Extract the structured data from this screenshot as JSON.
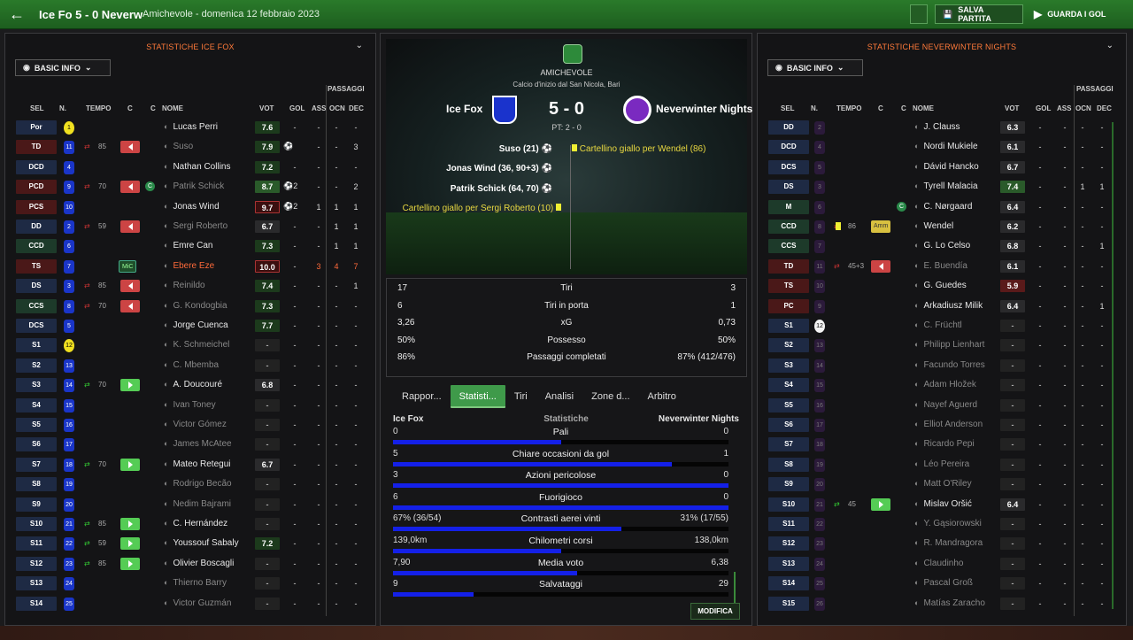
{
  "header": {
    "title": "Ice Fo 5 - 0 Neverw",
    "subtitle": "Amichevole - domenica 12 febbraio 2023",
    "save_label": "SALVA PARTITA",
    "watch_label": "GUARDA I GOL"
  },
  "left": {
    "title": "STATISTICHE ICE FOX",
    "view": "BASIC INFO",
    "passes_header": "PASSAGGI",
    "cols": {
      "sel": "SEL",
      "n": "N.",
      "tempo": "TEMPO",
      "c1": "C",
      "c2": "C",
      "nome": "NOME",
      "vot": "VOT",
      "gol": "GOL",
      "ass": "ASS",
      "ocn": "OCN",
      "dec": "DEC"
    },
    "players": [
      {
        "pos": "Por",
        "n": "1",
        "name": "Lucas Perri",
        "vot": "7.6",
        "gol": "-",
        "ass": "-",
        "ocn": "-",
        "dec": "-"
      },
      {
        "pos": "TD",
        "n": "11",
        "mins": "85",
        "name": "Suso",
        "vot": "7.9",
        "gol": "",
        "ass": "-",
        "ocn": "-",
        "dec": "3"
      },
      {
        "pos": "DCD",
        "n": "4",
        "name": "Nathan Collins",
        "vot": "7.2",
        "gol": "-",
        "ass": "-",
        "ocn": "-",
        "dec": "-"
      },
      {
        "pos": "PCD",
        "n": "9",
        "mins": "70",
        "name": "Patrik Schick",
        "vot": "8.7",
        "gol": "2",
        "ass": "-",
        "ocn": "-",
        "dec": "2"
      },
      {
        "pos": "PCS",
        "n": "10",
        "name": "Jonas Wind",
        "vot": "9.7",
        "gol": "2",
        "ass": "1",
        "ocn": "1",
        "dec": "1"
      },
      {
        "pos": "DD",
        "n": "2",
        "mins": "59",
        "name": "Sergi Roberto",
        "vot": "6.7",
        "gol": "-",
        "ass": "-",
        "ocn": "1",
        "dec": "1"
      },
      {
        "pos": "CCD",
        "n": "6",
        "name": "Emre Can",
        "vot": "7.3",
        "gol": "-",
        "ass": "-",
        "ocn": "1",
        "dec": "1"
      },
      {
        "pos": "TS",
        "n": "7",
        "tag": "MiC",
        "name": "Ebere Eze",
        "vot": "10.0",
        "gol": "-",
        "ass": "3",
        "ocn": "4",
        "dec": "7"
      },
      {
        "pos": "DS",
        "n": "3",
        "mins": "85",
        "name": "Reinildo",
        "vot": "7.4",
        "gol": "-",
        "ass": "-",
        "ocn": "-",
        "dec": "1"
      },
      {
        "pos": "CCS",
        "n": "8",
        "mins": "70",
        "name": "G. Kondogbia",
        "vot": "7.3",
        "gol": "-",
        "ass": "-",
        "ocn": "-",
        "dec": "-"
      },
      {
        "pos": "DCS",
        "n": "5",
        "name": "Jorge Cuenca",
        "vot": "7.7",
        "gol": "-",
        "ass": "-",
        "ocn": "-",
        "dec": "-"
      },
      {
        "pos": "S1",
        "n": "12",
        "name": "K. Schmeichel",
        "vot": "-",
        "gol": "-",
        "ass": "-",
        "ocn": "-",
        "dec": "-"
      },
      {
        "pos": "S2",
        "n": "13",
        "name": "C. Mbemba",
        "vot": "-",
        "gol": "-",
        "ass": "-",
        "ocn": "-",
        "dec": "-"
      },
      {
        "pos": "S3",
        "n": "14",
        "mins": "70",
        "name": "A. Doucouré",
        "vot": "6.8",
        "gol": "-",
        "ass": "-",
        "ocn": "-",
        "dec": "-"
      },
      {
        "pos": "S4",
        "n": "15",
        "name": "Ivan Toney",
        "vot": "-",
        "gol": "-",
        "ass": "-",
        "ocn": "-",
        "dec": "-"
      },
      {
        "pos": "S5",
        "n": "16",
        "name": "Victor Gómez",
        "vot": "-",
        "gol": "-",
        "ass": "-",
        "ocn": "-",
        "dec": "-"
      },
      {
        "pos": "S6",
        "n": "17",
        "name": "James McAtee",
        "vot": "-",
        "gol": "-",
        "ass": "-",
        "ocn": "-",
        "dec": "-"
      },
      {
        "pos": "S7",
        "n": "18",
        "mins": "70",
        "name": "Mateo Retegui",
        "vot": "6.7",
        "gol": "-",
        "ass": "-",
        "ocn": "-",
        "dec": "-"
      },
      {
        "pos": "S8",
        "n": "19",
        "name": "Rodrigo Becão",
        "vot": "-",
        "gol": "-",
        "ass": "-",
        "ocn": "-",
        "dec": "-"
      },
      {
        "pos": "S9",
        "n": "20",
        "name": "Nedim Bajrami",
        "vot": "-",
        "gol": "-",
        "ass": "-",
        "ocn": "-",
        "dec": "-"
      },
      {
        "pos": "S10",
        "n": "21",
        "mins": "85",
        "name": "C. Hernández",
        "vot": "-",
        "gol": "-",
        "ass": "-",
        "ocn": "-",
        "dec": "-"
      },
      {
        "pos": "S11",
        "n": "22",
        "mins": "59",
        "name": "Youssouf Sabaly",
        "vot": "7.2",
        "gol": "-",
        "ass": "-",
        "ocn": "-",
        "dec": "-"
      },
      {
        "pos": "S12",
        "n": "23",
        "mins": "85",
        "name": "Olivier Boscagli",
        "vot": "-",
        "gol": "-",
        "ass": "-",
        "ocn": "-",
        "dec": "-"
      },
      {
        "pos": "S13",
        "n": "24",
        "name": "Thierno Barry",
        "vot": "-",
        "gol": "-",
        "ass": "-",
        "ocn": "-",
        "dec": "-"
      },
      {
        "pos": "S14",
        "n": "25",
        "name": "Victor Guzmán",
        "vot": "-",
        "gol": "-",
        "ass": "-",
        "ocn": "-",
        "dec": "-"
      }
    ]
  },
  "right": {
    "title": "STATISTICHE NEVERWINTER NIGHTS",
    "view": "BASIC INFO",
    "passes_header": "PASSAGGI",
    "cols": {
      "sel": "SEL",
      "n": "N.",
      "tempo": "TEMPO",
      "c1": "C",
      "c2": "C",
      "nome": "NOME",
      "vot": "VOT",
      "gol": "GOL",
      "ass": "ASS",
      "ocn": "OCN",
      "dec": "DEC"
    },
    "players": [
      {
        "pos": "DD",
        "n": "2",
        "name": "J. Clauss",
        "vot": "6.3",
        "gol": "-",
        "ass": "-",
        "ocn": "-",
        "dec": "-"
      },
      {
        "pos": "DCD",
        "n": "4",
        "name": "Nordi Mukiele",
        "vot": "6.1",
        "gol": "-",
        "ass": "-",
        "ocn": "-",
        "dec": "-"
      },
      {
        "pos": "DCS",
        "n": "5",
        "name": "Dávid Hancko",
        "vot": "6.7",
        "gol": "-",
        "ass": "-",
        "ocn": "-",
        "dec": "-"
      },
      {
        "pos": "DS",
        "n": "3",
        "name": "Tyrell Malacia",
        "vot": "7.4",
        "gol": "-",
        "ass": "-",
        "ocn": "1",
        "dec": "1"
      },
      {
        "pos": "M",
        "n": "6",
        "name": "C. Nørgaard",
        "vot": "6.4",
        "gol": "-",
        "ass": "-",
        "ocn": "-",
        "dec": "-"
      },
      {
        "pos": "CCD",
        "n": "8",
        "mins": "86",
        "tag": "Amm",
        "name": "Wendel",
        "vot": "6.2",
        "gol": "-",
        "ass": "-",
        "ocn": "-",
        "dec": "-"
      },
      {
        "pos": "CCS",
        "n": "7",
        "name": "G. Lo Celso",
        "vot": "6.8",
        "gol": "-",
        "ass": "-",
        "ocn": "-",
        "dec": "1"
      },
      {
        "pos": "TD",
        "n": "11",
        "mins": "45+3",
        "name": "E. Buendía",
        "vot": "6.1",
        "gol": "-",
        "ass": "-",
        "ocn": "-",
        "dec": "-"
      },
      {
        "pos": "TS",
        "n": "10",
        "name": "G. Guedes",
        "vot": "5.9",
        "gol": "-",
        "ass": "-",
        "ocn": "-",
        "dec": "-"
      },
      {
        "pos": "PC",
        "n": "9",
        "name": "Arkadiusz Milik",
        "vot": "6.4",
        "gol": "-",
        "ass": "-",
        "ocn": "-",
        "dec": "1"
      },
      {
        "pos": "S1",
        "n": "12",
        "name": "C. Früchtl",
        "vot": "-",
        "gol": "-",
        "ass": "-",
        "ocn": "-",
        "dec": "-"
      },
      {
        "pos": "S2",
        "n": "13",
        "name": "Philipp Lienhart",
        "vot": "-",
        "gol": "-",
        "ass": "-",
        "ocn": "-",
        "dec": "-"
      },
      {
        "pos": "S3",
        "n": "14",
        "name": "Facundo Torres",
        "vot": "-",
        "gol": "-",
        "ass": "-",
        "ocn": "-",
        "dec": "-"
      },
      {
        "pos": "S4",
        "n": "15",
        "name": "Adam Hložek",
        "vot": "-",
        "gol": "-",
        "ass": "-",
        "ocn": "-",
        "dec": "-"
      },
      {
        "pos": "S5",
        "n": "16",
        "name": "Nayef Aguerd",
        "vot": "-",
        "gol": "-",
        "ass": "-",
        "ocn": "-",
        "dec": "-"
      },
      {
        "pos": "S6",
        "n": "17",
        "name": "Elliot Anderson",
        "vot": "-",
        "gol": "-",
        "ass": "-",
        "ocn": "-",
        "dec": "-"
      },
      {
        "pos": "S7",
        "n": "18",
        "name": "Ricardo Pepi",
        "vot": "-",
        "gol": "-",
        "ass": "-",
        "ocn": "-",
        "dec": "-"
      },
      {
        "pos": "S8",
        "n": "19",
        "name": "Léo Pereira",
        "vot": "-",
        "gol": "-",
        "ass": "-",
        "ocn": "-",
        "dec": "-"
      },
      {
        "pos": "S9",
        "n": "20",
        "name": "Matt O'Riley",
        "vot": "-",
        "gol": "-",
        "ass": "-",
        "ocn": "-",
        "dec": "-"
      },
      {
        "pos": "S10",
        "n": "21",
        "mins": "45",
        "name": "Mislav Oršić",
        "vot": "6.4",
        "gol": "-",
        "ass": "-",
        "ocn": "-",
        "dec": "-"
      },
      {
        "pos": "S11",
        "n": "22",
        "name": "Y. Gąsiorowski",
        "vot": "-",
        "gol": "-",
        "ass": "-",
        "ocn": "-",
        "dec": "-"
      },
      {
        "pos": "S12",
        "n": "23",
        "name": "R. Mandragora",
        "vot": "-",
        "gol": "-",
        "ass": "-",
        "ocn": "-",
        "dec": "-"
      },
      {
        "pos": "S13",
        "n": "24",
        "name": "Claudinho",
        "vot": "-",
        "gol": "-",
        "ass": "-",
        "ocn": "-",
        "dec": "-"
      },
      {
        "pos": "S14",
        "n": "25",
        "name": "Pascal Groß",
        "vot": "-",
        "gol": "-",
        "ass": "-",
        "ocn": "-",
        "dec": "-"
      },
      {
        "pos": "S15",
        "n": "26",
        "name": "Matías Zaracho",
        "vot": "-",
        "gol": "-",
        "ass": "-",
        "ocn": "-",
        "dec": "-"
      }
    ]
  },
  "match": {
    "competition": "AMICHEVOLE",
    "venue": "Calcio d'inizio dal San Nicola, Bari",
    "home": "Ice Fox",
    "away": "Neverwinter Nights",
    "score": "5 - 0",
    "halftime": "PT: 2 - 0",
    "events": {
      "e1": "Suso (21)",
      "e2": "Jonas Wind (36, 90+3)",
      "e3": "Patrik Schick (64, 70)",
      "e4": "Cartellino giallo per Sergi Roberto (10)",
      "e5": "Cartellino giallo per Wendel (86)"
    }
  },
  "summary": [
    {
      "l": "17",
      "c": "Tiri",
      "r": "3"
    },
    {
      "l": "6",
      "c": "Tiri in porta",
      "r": "1"
    },
    {
      "l": "3,26",
      "c": "xG",
      "r": "0,73"
    },
    {
      "l": "50%",
      "c": "Possesso",
      "r": "50%"
    },
    {
      "l": "86%",
      "c": "Passaggi completati",
      "r": "87% (412/476)"
    }
  ],
  "tabs": [
    "Rappor...",
    "Statisti...",
    "Tiri",
    "Analisi",
    "Zone d...",
    "Arbitro"
  ],
  "stats_header": {
    "home": "Ice Fox",
    "mid": "Statistiche",
    "away": "Neverwinter Nights"
  },
  "stats": [
    {
      "l": "0",
      "c": "Pali",
      "r": "0",
      "fill": 0.5
    },
    {
      "l": "5",
      "c": "Chiare occasioni da gol",
      "r": "1",
      "fill": 0.83
    },
    {
      "l": "3",
      "c": "Azioni pericolose",
      "r": "0",
      "fill": 1.0
    },
    {
      "l": "6",
      "c": "Fuorigioco",
      "r": "0",
      "fill": 1.0
    },
    {
      "l": "67% (36/54)",
      "c": "Contrasti aerei vinti",
      "r": "31% (17/55)",
      "fill": 0.68
    },
    {
      "l": "139,0km",
      "c": "Chilometri corsi",
      "r": "138,0km",
      "fill": 0.5
    },
    {
      "l": "7,90",
      "c": "Media voto",
      "r": "6,38",
      "fill": 0.55
    },
    {
      "l": "9",
      "c": "Salvataggi",
      "r": "29",
      "fill": 0.24
    }
  ],
  "modify_label": "MODIFICA"
}
